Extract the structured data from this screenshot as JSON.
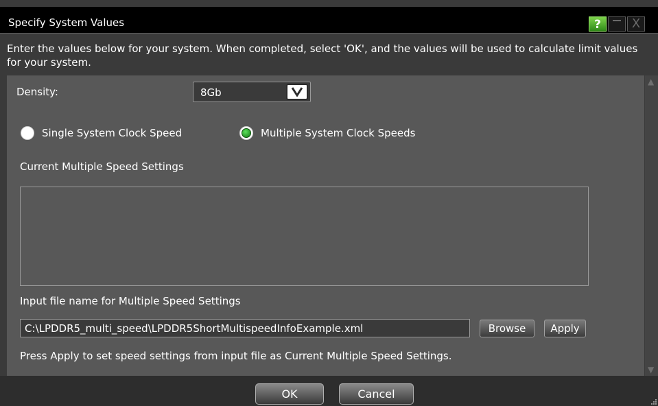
{
  "window": {
    "title": "Specify System Values"
  },
  "titlebar_buttons": {
    "help": "?",
    "close": "X"
  },
  "intro": "Enter the values below for your system. When completed, select 'OK', and the values will be used to calculate limit values for your system.",
  "density": {
    "label": "Density:",
    "value": "8Gb"
  },
  "clock_mode": {
    "options": [
      "Single System Clock Speed",
      "Multiple System Clock Speeds"
    ],
    "selected": "Multiple System Clock Speeds"
  },
  "current_settings": {
    "label": "Current Multiple Speed Settings"
  },
  "input_file": {
    "label": "Input file name for Multiple Speed Settings",
    "value": "C:\\LPDDR5_multi_speed\\LPDDR5ShortMultispeedInfoExample.xml",
    "browse_label": "Browse",
    "apply_label": "Apply"
  },
  "hint": "Press Apply to set speed settings from input file as Current Multiple Speed Settings.",
  "footer": {
    "ok_label": "OK",
    "cancel_label": "Cancel"
  },
  "colors": {
    "accent_green": "#3aa82a",
    "background": "#3a3a3a",
    "panel": "#585858"
  },
  "icons": [
    "help-icon",
    "minimize-icon",
    "close-icon",
    "dropdown-arrow-icon",
    "scroll-up-icon",
    "scroll-down-icon",
    "resize-grip-icon"
  ]
}
